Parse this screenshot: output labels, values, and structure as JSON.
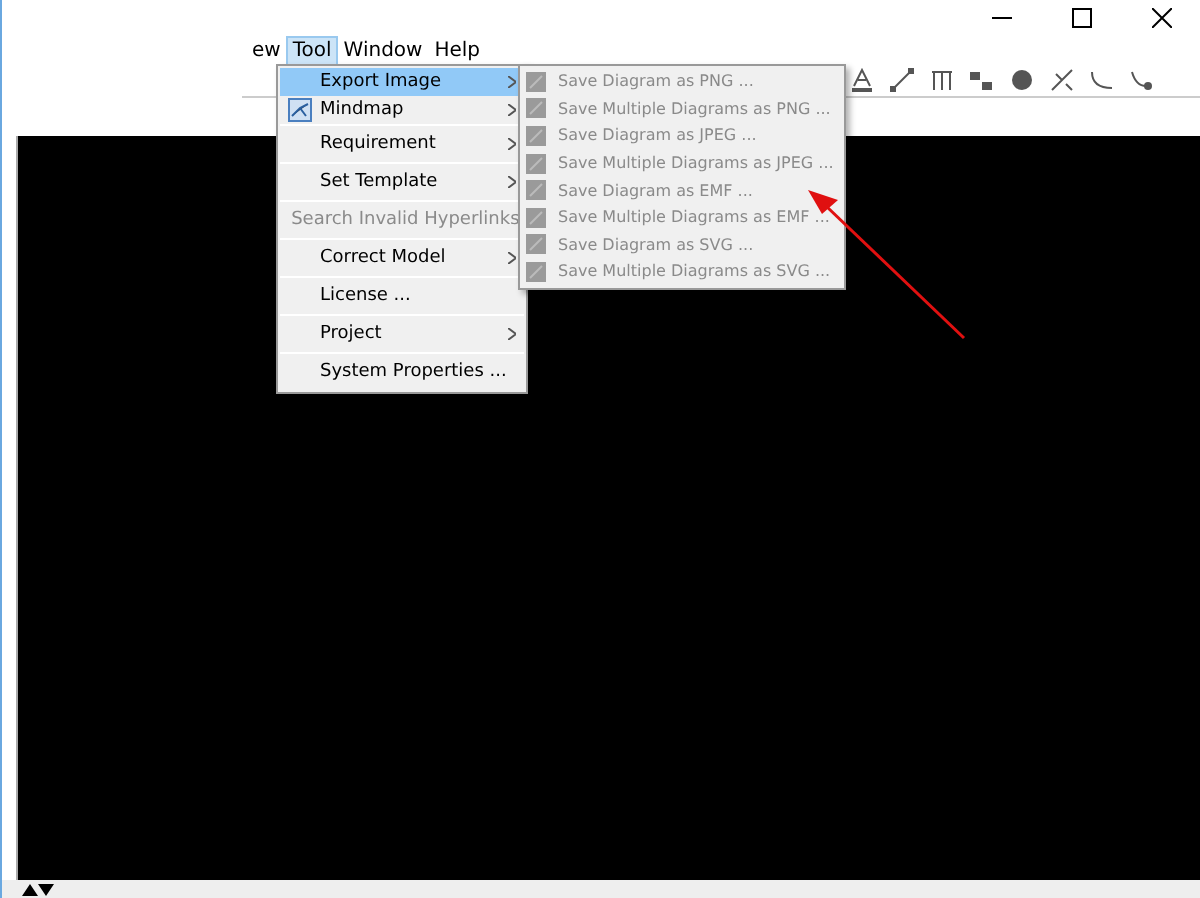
{
  "menubar": [
    {
      "label": "ew",
      "selected": false
    },
    {
      "label": "Tool",
      "selected": true
    },
    {
      "label": "Window",
      "selected": false
    },
    {
      "label": "Help",
      "selected": false
    }
  ],
  "tool_menu": [
    {
      "label": "Export Image",
      "kind": "plain",
      "submenu": true,
      "selected": true,
      "disabled": false
    },
    {
      "label": "Mindmap",
      "kind": "icon",
      "submenu": true,
      "selected": false,
      "disabled": false
    },
    {
      "label": "Requirement",
      "kind": "plain",
      "submenu": true,
      "selected": false,
      "disabled": false
    },
    {
      "label": "Set Template",
      "kind": "plain",
      "submenu": true,
      "selected": false,
      "disabled": false
    },
    {
      "label": "Search Invalid Hyperlinks",
      "kind": "plain",
      "submenu": false,
      "selected": false,
      "disabled": true
    },
    {
      "label": "Correct Model",
      "kind": "plain",
      "submenu": true,
      "selected": false,
      "disabled": false
    },
    {
      "label": "License ...",
      "kind": "plain",
      "submenu": false,
      "selected": false,
      "disabled": false
    },
    {
      "label": "Project",
      "kind": "plain",
      "submenu": true,
      "selected": false,
      "disabled": false
    },
    {
      "label": "System Properties ...",
      "kind": "plain",
      "submenu": false,
      "selected": false,
      "disabled": false
    }
  ],
  "export_submenu": [
    {
      "label": "Save Diagram as PNG ...",
      "disabled": true
    },
    {
      "label": "Save Multiple Diagrams as PNG ...",
      "disabled": true
    },
    {
      "label": "Save Diagram as JPEG ...",
      "disabled": true
    },
    {
      "label": "Save Multiple Diagrams as JPEG ...",
      "disabled": true
    },
    {
      "label": "Save Diagram as EMF ...",
      "disabled": true
    },
    {
      "label": "Save Multiple Diagrams as EMF ...",
      "disabled": true
    },
    {
      "label": "Save Diagram as SVG ...",
      "disabled": true
    },
    {
      "label": "Save Multiple Diagrams as SVG ...",
      "disabled": true
    }
  ]
}
